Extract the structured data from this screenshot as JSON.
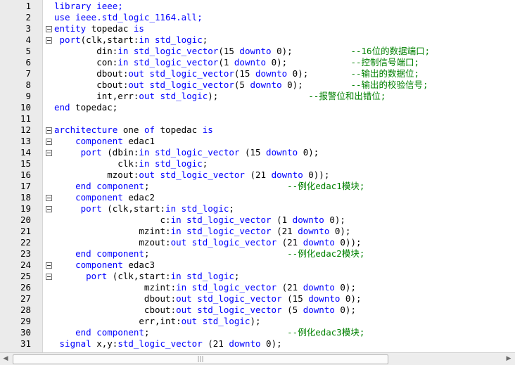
{
  "editor": {
    "lines": [
      {
        "num": "1",
        "fold": false,
        "tokens": [
          {
            "t": "kw",
            "v": "library ieee;"
          }
        ]
      },
      {
        "num": "2",
        "fold": false,
        "tokens": [
          {
            "t": "kw",
            "v": "use ieee.std_logic_1164.all;"
          }
        ]
      },
      {
        "num": "3",
        "fold": true,
        "tokens": [
          {
            "t": "kw",
            "v": "entity "
          },
          {
            "t": "tx",
            "v": "topedac "
          },
          {
            "t": "kw",
            "v": "is"
          }
        ]
      },
      {
        "num": "4",
        "fold": true,
        "tokens": [
          {
            "t": "kw",
            "v": " port"
          },
          {
            "t": "tx",
            "v": "(clk,start:"
          },
          {
            "t": "kw",
            "v": "in std_logic"
          },
          {
            "t": "tx",
            "v": ";"
          }
        ]
      },
      {
        "num": "5",
        "fold": false,
        "tokens": [
          {
            "t": "tx",
            "v": "        din:"
          },
          {
            "t": "kw",
            "v": "in std_logic_vector"
          },
          {
            "t": "tx",
            "v": "(15 "
          },
          {
            "t": "kw",
            "v": "downto"
          },
          {
            "t": "tx",
            "v": " 0);           "
          },
          {
            "t": "cm",
            "v": "--16位的数据端口;"
          }
        ]
      },
      {
        "num": "6",
        "fold": false,
        "tokens": [
          {
            "t": "tx",
            "v": "        con:"
          },
          {
            "t": "kw",
            "v": "in std_logic_vector"
          },
          {
            "t": "tx",
            "v": "(1 "
          },
          {
            "t": "kw",
            "v": "downto"
          },
          {
            "t": "tx",
            "v": " 0);            "
          },
          {
            "t": "cm",
            "v": "--控制信号端口;"
          }
        ]
      },
      {
        "num": "7",
        "fold": false,
        "tokens": [
          {
            "t": "tx",
            "v": "        dbout:"
          },
          {
            "t": "kw",
            "v": "out std_logic_vector"
          },
          {
            "t": "tx",
            "v": "(15 "
          },
          {
            "t": "kw",
            "v": "downto"
          },
          {
            "t": "tx",
            "v": " 0);        "
          },
          {
            "t": "cm",
            "v": "--输出的数据位;"
          }
        ]
      },
      {
        "num": "8",
        "fold": false,
        "tokens": [
          {
            "t": "tx",
            "v": "        cbout:"
          },
          {
            "t": "kw",
            "v": "out std_logic_vector"
          },
          {
            "t": "tx",
            "v": "(5 "
          },
          {
            "t": "kw",
            "v": "downto"
          },
          {
            "t": "tx",
            "v": " 0);         "
          },
          {
            "t": "cm",
            "v": "--输出的校验信号;"
          }
        ]
      },
      {
        "num": "9",
        "fold": false,
        "tokens": [
          {
            "t": "tx",
            "v": "        int,err:"
          },
          {
            "t": "kw",
            "v": "out std_logic"
          },
          {
            "t": "tx",
            "v": ");                 "
          },
          {
            "t": "cm",
            "v": "--报警位和出错位;"
          }
        ]
      },
      {
        "num": "10",
        "fold": false,
        "tokens": [
          {
            "t": "kw",
            "v": "end "
          },
          {
            "t": "tx",
            "v": "topedac;"
          }
        ]
      },
      {
        "num": "11",
        "fold": false,
        "tokens": []
      },
      {
        "num": "12",
        "fold": true,
        "tokens": [
          {
            "t": "kw",
            "v": "architecture "
          },
          {
            "t": "tx",
            "v": "one "
          },
          {
            "t": "kw",
            "v": "of "
          },
          {
            "t": "tx",
            "v": "topedac "
          },
          {
            "t": "kw",
            "v": "is"
          }
        ]
      },
      {
        "num": "13",
        "fold": true,
        "tokens": [
          {
            "t": "tx",
            "v": "    "
          },
          {
            "t": "kw",
            "v": "component "
          },
          {
            "t": "tx",
            "v": "edac1"
          }
        ]
      },
      {
        "num": "14",
        "fold": true,
        "tokens": [
          {
            "t": "kw",
            "v": "     port "
          },
          {
            "t": "tx",
            "v": "(dbin:"
          },
          {
            "t": "kw",
            "v": "in std_logic_vector "
          },
          {
            "t": "tx",
            "v": "(15 "
          },
          {
            "t": "kw",
            "v": "downto"
          },
          {
            "t": "tx",
            "v": " 0);"
          }
        ]
      },
      {
        "num": "15",
        "fold": false,
        "tokens": [
          {
            "t": "tx",
            "v": "            clk:"
          },
          {
            "t": "kw",
            "v": "in std_logic"
          },
          {
            "t": "tx",
            "v": ";"
          }
        ]
      },
      {
        "num": "16",
        "fold": false,
        "tokens": [
          {
            "t": "tx",
            "v": "          mzout:"
          },
          {
            "t": "kw",
            "v": "out std_logic_vector "
          },
          {
            "t": "tx",
            "v": "(21 "
          },
          {
            "t": "kw",
            "v": "downto"
          },
          {
            "t": "tx",
            "v": " 0));"
          }
        ]
      },
      {
        "num": "17",
        "fold": false,
        "tokens": [
          {
            "t": "tx",
            "v": "    "
          },
          {
            "t": "kw",
            "v": "end component"
          },
          {
            "t": "tx",
            "v": ";                          "
          },
          {
            "t": "cm",
            "v": "--例化edac1模块;"
          }
        ]
      },
      {
        "num": "18",
        "fold": true,
        "tokens": [
          {
            "t": "tx",
            "v": "    "
          },
          {
            "t": "kw",
            "v": "component "
          },
          {
            "t": "tx",
            "v": "edac2"
          }
        ]
      },
      {
        "num": "19",
        "fold": true,
        "tokens": [
          {
            "t": "kw",
            "v": "     port "
          },
          {
            "t": "tx",
            "v": "(clk,start:"
          },
          {
            "t": "kw",
            "v": "in std_logic"
          },
          {
            "t": "tx",
            "v": ";"
          }
        ]
      },
      {
        "num": "20",
        "fold": false,
        "tokens": [
          {
            "t": "tx",
            "v": "                    c:"
          },
          {
            "t": "kw",
            "v": "in std_logic_vector "
          },
          {
            "t": "tx",
            "v": "(1 "
          },
          {
            "t": "kw",
            "v": "downto"
          },
          {
            "t": "tx",
            "v": " 0);"
          }
        ]
      },
      {
        "num": "21",
        "fold": false,
        "tokens": [
          {
            "t": "tx",
            "v": "                mzint:"
          },
          {
            "t": "kw",
            "v": "in std_logic_vector "
          },
          {
            "t": "tx",
            "v": "(21 "
          },
          {
            "t": "kw",
            "v": "downto"
          },
          {
            "t": "tx",
            "v": " 0);"
          }
        ]
      },
      {
        "num": "22",
        "fold": false,
        "tokens": [
          {
            "t": "tx",
            "v": "                mzout:"
          },
          {
            "t": "kw",
            "v": "out std_logic_vector "
          },
          {
            "t": "tx",
            "v": "(21 "
          },
          {
            "t": "kw",
            "v": "downto"
          },
          {
            "t": "tx",
            "v": " 0));"
          }
        ]
      },
      {
        "num": "23",
        "fold": false,
        "tokens": [
          {
            "t": "tx",
            "v": "    "
          },
          {
            "t": "kw",
            "v": "end component"
          },
          {
            "t": "tx",
            "v": ";                          "
          },
          {
            "t": "cm",
            "v": "--例化edac2模块;"
          }
        ]
      },
      {
        "num": "24",
        "fold": true,
        "tokens": [
          {
            "t": "tx",
            "v": "    "
          },
          {
            "t": "kw",
            "v": "component "
          },
          {
            "t": "tx",
            "v": "edac3"
          }
        ]
      },
      {
        "num": "25",
        "fold": true,
        "tokens": [
          {
            "t": "kw",
            "v": "      port "
          },
          {
            "t": "tx",
            "v": "(clk,start:"
          },
          {
            "t": "kw",
            "v": "in std_logic"
          },
          {
            "t": "tx",
            "v": ";"
          }
        ]
      },
      {
        "num": "26",
        "fold": false,
        "tokens": [
          {
            "t": "tx",
            "v": "                 mzint:"
          },
          {
            "t": "kw",
            "v": "in std_logic_vector "
          },
          {
            "t": "tx",
            "v": "(21 "
          },
          {
            "t": "kw",
            "v": "downto"
          },
          {
            "t": "tx",
            "v": " 0);"
          }
        ]
      },
      {
        "num": "27",
        "fold": false,
        "tokens": [
          {
            "t": "tx",
            "v": "                 dbout:"
          },
          {
            "t": "kw",
            "v": "out std_logic_vector "
          },
          {
            "t": "tx",
            "v": "(15 "
          },
          {
            "t": "kw",
            "v": "downto"
          },
          {
            "t": "tx",
            "v": " 0);"
          }
        ]
      },
      {
        "num": "28",
        "fold": false,
        "tokens": [
          {
            "t": "tx",
            "v": "                 cbout:"
          },
          {
            "t": "kw",
            "v": "out std_logic_vector "
          },
          {
            "t": "tx",
            "v": "(5 "
          },
          {
            "t": "kw",
            "v": "downto"
          },
          {
            "t": "tx",
            "v": " 0);"
          }
        ]
      },
      {
        "num": "29",
        "fold": false,
        "tokens": [
          {
            "t": "tx",
            "v": "                err,int:"
          },
          {
            "t": "kw",
            "v": "out std_logic"
          },
          {
            "t": "tx",
            "v": ");"
          }
        ]
      },
      {
        "num": "30",
        "fold": false,
        "tokens": [
          {
            "t": "tx",
            "v": "    "
          },
          {
            "t": "kw",
            "v": "end component"
          },
          {
            "t": "tx",
            "v": ";                          "
          },
          {
            "t": "cm",
            "v": "--例化edac3模块;"
          }
        ]
      },
      {
        "num": "31",
        "fold": false,
        "tokens": [
          {
            "t": "tx",
            "v": " "
          },
          {
            "t": "kw",
            "v": "signal "
          },
          {
            "t": "tx",
            "v": "x,y:"
          },
          {
            "t": "kw",
            "v": "std_logic_vector "
          },
          {
            "t": "tx",
            "v": "(21 "
          },
          {
            "t": "kw",
            "v": "downto"
          },
          {
            "t": "tx",
            "v": " 0);"
          }
        ]
      }
    ]
  },
  "scrollbar": {
    "left_arrow": "◀",
    "right_arrow": "▶",
    "grip": "|||"
  },
  "colors": {
    "keyword": "#0000ff",
    "comment": "#008000",
    "text": "#000000",
    "gutter": "#ebebeb"
  },
  "icons": {
    "fold": "fold-minus-icon"
  }
}
